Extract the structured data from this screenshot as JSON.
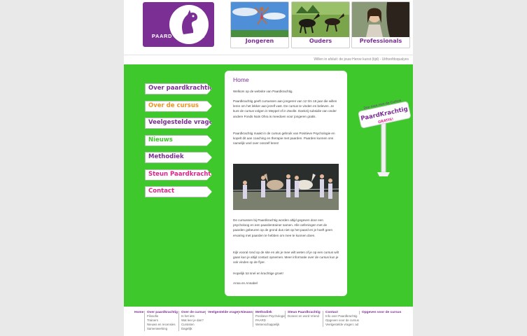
{
  "colors": {
    "purple": "#7b2f95",
    "green": "#3ec82b",
    "orange": "#f0931c"
  },
  "header": {
    "logo_text": "PAARD KRACHTIG",
    "photos": [
      {
        "caption": "Jongeren",
        "icon": "jumping-girl-photo"
      },
      {
        "caption": "Ouders",
        "icon": "horses-photo"
      },
      {
        "caption": "Professionals",
        "icon": "woman-with-horse-photo"
      }
    ],
    "tagline": "Willen in afsluit: de jouw Heroe kunst (tijd) - Uithoofdsqualyes"
  },
  "menu": [
    {
      "label": "Over paardkrachtig",
      "color": "#7b2f95"
    },
    {
      "label": "Over de cursus",
      "color": "#f0931c"
    },
    {
      "label": "Veelgestelde vragen",
      "color": "#7b2f95"
    },
    {
      "label": "Nieuws",
      "color": "#3ec82b"
    },
    {
      "label": "Methodiek",
      "color": "#7b2f95"
    },
    {
      "label": "Steun Paardkrachtig",
      "color": "#e0238a"
    },
    {
      "label": "Contact",
      "color": "#e0238a"
    }
  ],
  "content": {
    "title": "Home",
    "p1": "Welkom op de website van Paardkrachtig.",
    "p2": "Paardkrachtig geeft cursussen aan jongeren van 12 t/m 16 jaar die willen leren om het lekker aan jezelf vast. De cursus te vinden en beleven. Je kunt de cursus volgen in Meppel of in Zwolle. Dankzij subsidie van onder andere Fonds Nuts Ohra is meedoen voor jongeren gratis.",
    "p3": "Paardkrachtig maakt in de cursus gebruik van Positieve Psychologie en kopelt dit aan coaching en therapie met paarden. Paarden kunnen ons namelijk veel over onszelf leren!",
    "p4": "De cursussen bij Paardkrachtig worden altijd gegeven door een psycholoog en een paardentrainer samen. Alle oefeningen met de paarden gebeuren op de grond dus niet op het paard en je hoeft geen ervaring met paarden te hebben om mee te kunnen doen.",
    "p5": "Kijk vooral rond op de site en als je mee wilt weten of je op een cursus wilt gaan kun je altijd contact opnemen. Meer informatie over de cursus kun je ook vinden op de flyer.",
    "p6": "Hopelijk tot snel en krachtige groet!",
    "p7": "Anna en Annabel"
  },
  "sign": {
    "top_text": "Doe mee met de Cursus",
    "brand": "PaardKrachtig",
    "badge": "GRATIS!"
  },
  "footer": [
    {
      "head": "Home",
      "items": []
    },
    {
      "head": "Over paardkrachtig",
      "items": [
        "Filosofie",
        "Trainers",
        "Nieuws en recensies",
        "Samenwerking"
      ]
    },
    {
      "head": "Over de cursus",
      "items": [
        "Is het iets",
        "Wat leer je dan?",
        "Cursisten",
        "Dagelijk"
      ]
    },
    {
      "head": "Veelgestelde vragen",
      "items": []
    },
    {
      "head": "Nieuws",
      "items": []
    },
    {
      "head": "Methodiek",
      "items": [
        "Positieve Psychologie",
        "PAARD",
        "Wetenschappelijk"
      ]
    },
    {
      "head": "Steun Paardkrachtig",
      "items": [
        "Doneer en word Vriend"
      ]
    },
    {
      "head": "Contact",
      "items": [
        "Info over Paardkrachtig",
        "Opgeven voor de cursus",
        "Veelgestelde vragen: ad"
      ]
    },
    {
      "head": "Opgeven voor de cursus",
      "items": []
    }
  ]
}
